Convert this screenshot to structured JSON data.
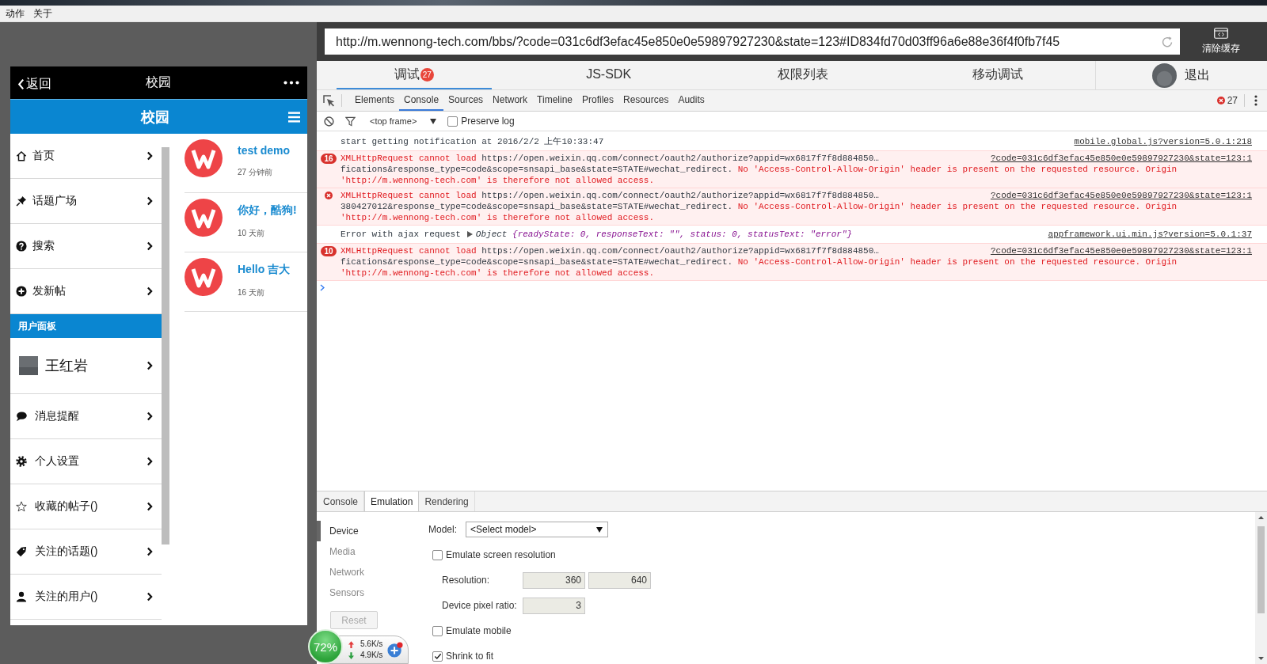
{
  "window": {
    "menu": [
      {
        "label": "动作"
      },
      {
        "label": "关于"
      }
    ]
  },
  "phone": {
    "nav_bar": {
      "back": "返回",
      "title": "校园"
    },
    "header": {
      "title": "校园"
    },
    "menu": [
      {
        "label": "首页"
      },
      {
        "label": "话题广场"
      },
      {
        "label": "搜索"
      },
      {
        "label": "发新帖"
      }
    ],
    "section_title": "用户面板",
    "user": {
      "name": "王红岩"
    },
    "user_menu": [
      {
        "label": "消息提醒"
      },
      {
        "label": "个人设置"
      },
      {
        "label": "收藏的帖子()"
      },
      {
        "label": "关注的话题()"
      },
      {
        "label": "关注的用户()"
      }
    ],
    "posts": [
      {
        "title": "test demo",
        "time": "27 分钟前"
      },
      {
        "title": "你好，酷狗!",
        "time": "10 天前"
      },
      {
        "title": "Hello 吉大",
        "time": "16 天前"
      }
    ]
  },
  "address_bar": {
    "url": "http://m.wennong-tech.com/bbs/?code=031c6df3efac45e850e0e59897927230&state=123#ID834fd70d03ff96a6e88e36f4f0fb7f45"
  },
  "clear_cache": {
    "label": "清除缓存"
  },
  "tabs": [
    {
      "label": "调试",
      "badge": "27",
      "selected": true
    },
    {
      "label": "JS-SDK",
      "selected": false
    },
    {
      "label": "权限列表",
      "selected": false
    },
    {
      "label": "移动调试",
      "selected": false
    }
  ],
  "account": {
    "logout": "退出"
  },
  "devtools": {
    "panels": [
      {
        "label": "Elements",
        "selected": false
      },
      {
        "label": "Console",
        "selected": true
      },
      {
        "label": "Sources",
        "selected": false
      },
      {
        "label": "Network",
        "selected": false
      },
      {
        "label": "Timeline",
        "selected": false
      },
      {
        "label": "Profiles",
        "selected": false
      },
      {
        "label": "Resources",
        "selected": false
      },
      {
        "label": "Audits",
        "selected": false
      }
    ],
    "error_count": "27",
    "console": {
      "context": "<top frame>",
      "preserve_log": {
        "label": "Preserve log",
        "checked": false
      },
      "messages": [
        {
          "kind": "log",
          "text": "start getting notification at 2016/2/2 上午10:33:47",
          "source": "mobile.global.js?version=5.0.1:218"
        },
        {
          "kind": "error",
          "count": "16",
          "lines": [
            [
              {
                "kind": "message",
                "text": "XMLHttpRequest cannot load"
              },
              {
                "kind": "url",
                "text": "https://open.weixin.qq.com/connect/oauth2/authorize?appid=wx6817f7f8d884850…"
              }
            ],
            [
              {
                "kind": "url",
                "text": "fications&response_type=code&scope=snsapi_base&state=STATE#wechat_redirect."
              },
              {
                "kind": "message",
                "text": "No 'Access-Control-Allow-Origin' header is present on the requested resource. Origin"
              }
            ],
            [
              {
                "kind": "message",
                "text": "'http://m.wennong-tech.com' is therefore not allowed access."
              }
            ]
          ],
          "source": "?code=031c6df3efac45e850e0e59897927230&state=123:1"
        },
        {
          "kind": "error",
          "lines": [
            [
              {
                "kind": "message",
                "text": "XMLHttpRequest cannot load"
              },
              {
                "kind": "url",
                "text": "https://open.weixin.qq.com/connect/oauth2/authorize?appid=wx6817f7f8d884850…"
              }
            ],
            [
              {
                "kind": "url",
                "text": "380427012&response_type=code&scope=snsapi_base&state=STATE#wechat_redirect."
              },
              {
                "kind": "message",
                "text": "No 'Access-Control-Allow-Origin' header is present on the requested resource. Origin"
              }
            ],
            [
              {
                "kind": "message",
                "text": "'http://m.wennong-tech.com' is therefore not allowed access."
              }
            ]
          ],
          "source": "?code=031c6df3efac45e850e0e59897927230&state=123:1"
        },
        {
          "kind": "object-log",
          "text": "Error with ajax request",
          "object": "Object",
          "preview": "{readyState: 0, responseText: \"\", status: 0, statusText: \"error\"}",
          "source": "appframework.ui.min.js?version=5.0.1:37"
        },
        {
          "kind": "error",
          "count": "10",
          "lines": [
            [
              {
                "kind": "message",
                "text": "XMLHttpRequest cannot load"
              },
              {
                "kind": "url",
                "text": "https://open.weixin.qq.com/connect/oauth2/authorize?appid=wx6817f7f8d884850…"
              }
            ],
            [
              {
                "kind": "url",
                "text": "fications&response_type=code&scope=snsapi_base&state=STATE#wechat_redirect."
              },
              {
                "kind": "message",
                "text": "No 'Access-Control-Allow-Origin' header is present on the requested resource. Origin"
              }
            ],
            [
              {
                "kind": "message",
                "text": "'http://m.wennong-tech.com' is therefore not allowed access."
              }
            ]
          ],
          "source": "?code=031c6df3efac45e850e0e59897927230&state=123:1"
        }
      ]
    },
    "drawer": {
      "tabs": [
        {
          "label": "Console",
          "selected": false
        },
        {
          "label": "Emulation",
          "selected": true
        },
        {
          "label": "Rendering",
          "selected": false
        }
      ],
      "emulation": {
        "sections": [
          {
            "label": "Device",
            "selected": true
          },
          {
            "label": "Media",
            "selected": false
          },
          {
            "label": "Network",
            "selected": false
          },
          {
            "label": "Sensors",
            "selected": false
          }
        ],
        "reset": {
          "label": "Reset",
          "disabled": true
        },
        "model": {
          "label": "Model:",
          "value": "<Select model>"
        },
        "options": [
          {
            "kind": "checkbox",
            "label": "Emulate screen resolution",
            "checked": false
          },
          {
            "kind": "number-pair",
            "label": "Resolution:",
            "values": [
              "360",
              "640"
            ],
            "disabled": true
          },
          {
            "kind": "number",
            "label": "Device pixel ratio:",
            "value": "3",
            "disabled": true
          },
          {
            "kind": "checkbox",
            "label": "Emulate mobile",
            "checked": false
          },
          {
            "kind": "checkbox",
            "label": "Shrink to fit",
            "checked": true
          }
        ]
      }
    }
  },
  "speed_widget": {
    "percent": "72%",
    "upload": "5.6K/s",
    "download": "4.9K/s"
  }
}
